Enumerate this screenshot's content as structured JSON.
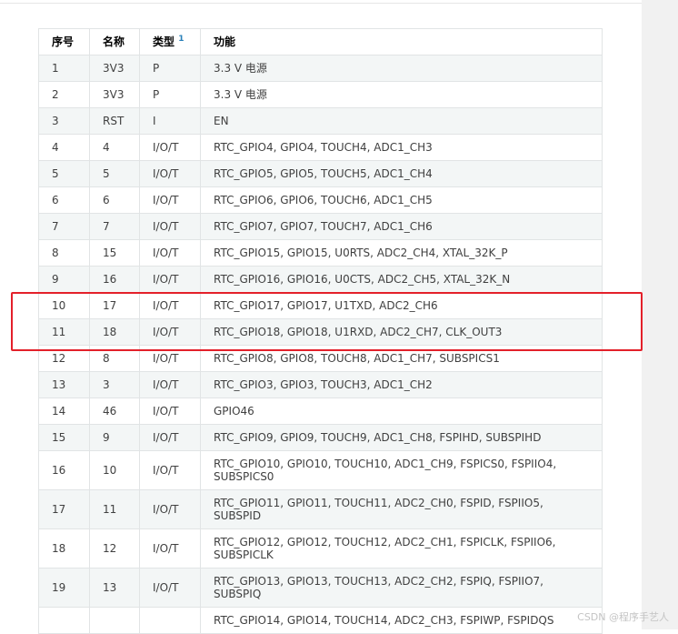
{
  "table": {
    "headers": {
      "index": "序号",
      "name": "名称",
      "type": "类型",
      "type_note": "1",
      "function": "功能"
    },
    "rows": [
      {
        "index": "1",
        "name": "3V3",
        "type": "P",
        "function": "3.3 V 电源"
      },
      {
        "index": "2",
        "name": "3V3",
        "type": "P",
        "function": "3.3 V 电源"
      },
      {
        "index": "3",
        "name": "RST",
        "type": "I",
        "function": "EN"
      },
      {
        "index": "4",
        "name": "4",
        "type": "I/O/T",
        "function": "RTC_GPIO4, GPIO4, TOUCH4, ADC1_CH3"
      },
      {
        "index": "5",
        "name": "5",
        "type": "I/O/T",
        "function": "RTC_GPIO5, GPIO5, TOUCH5, ADC1_CH4"
      },
      {
        "index": "6",
        "name": "6",
        "type": "I/O/T",
        "function": "RTC_GPIO6, GPIO6, TOUCH6, ADC1_CH5"
      },
      {
        "index": "7",
        "name": "7",
        "type": "I/O/T",
        "function": "RTC_GPIO7, GPIO7, TOUCH7, ADC1_CH6"
      },
      {
        "index": "8",
        "name": "15",
        "type": "I/O/T",
        "function": "RTC_GPIO15, GPIO15, U0RTS, ADC2_CH4, XTAL_32K_P"
      },
      {
        "index": "9",
        "name": "16",
        "type": "I/O/T",
        "function": "RTC_GPIO16, GPIO16, U0CTS, ADC2_CH5, XTAL_32K_N"
      },
      {
        "index": "10",
        "name": "17",
        "type": "I/O/T",
        "function": "RTC_GPIO17, GPIO17, U1TXD, ADC2_CH6"
      },
      {
        "index": "11",
        "name": "18",
        "type": "I/O/T",
        "function": "RTC_GPIO18, GPIO18, U1RXD, ADC2_CH7, CLK_OUT3"
      },
      {
        "index": "12",
        "name": "8",
        "type": "I/O/T",
        "function": "RTC_GPIO8, GPIO8, TOUCH8, ADC1_CH7, SUBSPICS1"
      },
      {
        "index": "13",
        "name": "3",
        "type": "I/O/T",
        "function": "RTC_GPIO3, GPIO3, TOUCH3, ADC1_CH2"
      },
      {
        "index": "14",
        "name": "46",
        "type": "I/O/T",
        "function": "GPIO46"
      },
      {
        "index": "15",
        "name": "9",
        "type": "I/O/T",
        "function": "RTC_GPIO9, GPIO9, TOUCH9, ADC1_CH8, FSPIHD, SUBSPIHD"
      },
      {
        "index": "16",
        "name": "10",
        "type": "I/O/T",
        "function": "RTC_GPIO10, GPIO10, TOUCH10, ADC1_CH9, FSPICS0, FSPIIO4, SUBSPICS0"
      },
      {
        "index": "17",
        "name": "11",
        "type": "I/O/T",
        "function": "RTC_GPIO11, GPIO11, TOUCH11, ADC2_CH0, FSPID, FSPIIO5, SUBSPID"
      },
      {
        "index": "18",
        "name": "12",
        "type": "I/O/T",
        "function": "RTC_GPIO12, GPIO12, TOUCH12, ADC2_CH1, FSPICLK, FSPIIO6, SUBSPICLK"
      },
      {
        "index": "19",
        "name": "13",
        "type": "I/O/T",
        "function": "RTC_GPIO13, GPIO13, TOUCH13, ADC2_CH2, FSPIQ, FSPIIO7, SUBSPIQ"
      },
      {
        "index": "",
        "name": "",
        "type": "",
        "function": "RTC_GPIO14, GPIO14, TOUCH14, ADC2_CH3, FSPIWP, FSPIDQS"
      }
    ]
  },
  "highlight": {
    "color": "#e3202a"
  },
  "watermark": "CSDN @程序手艺人"
}
